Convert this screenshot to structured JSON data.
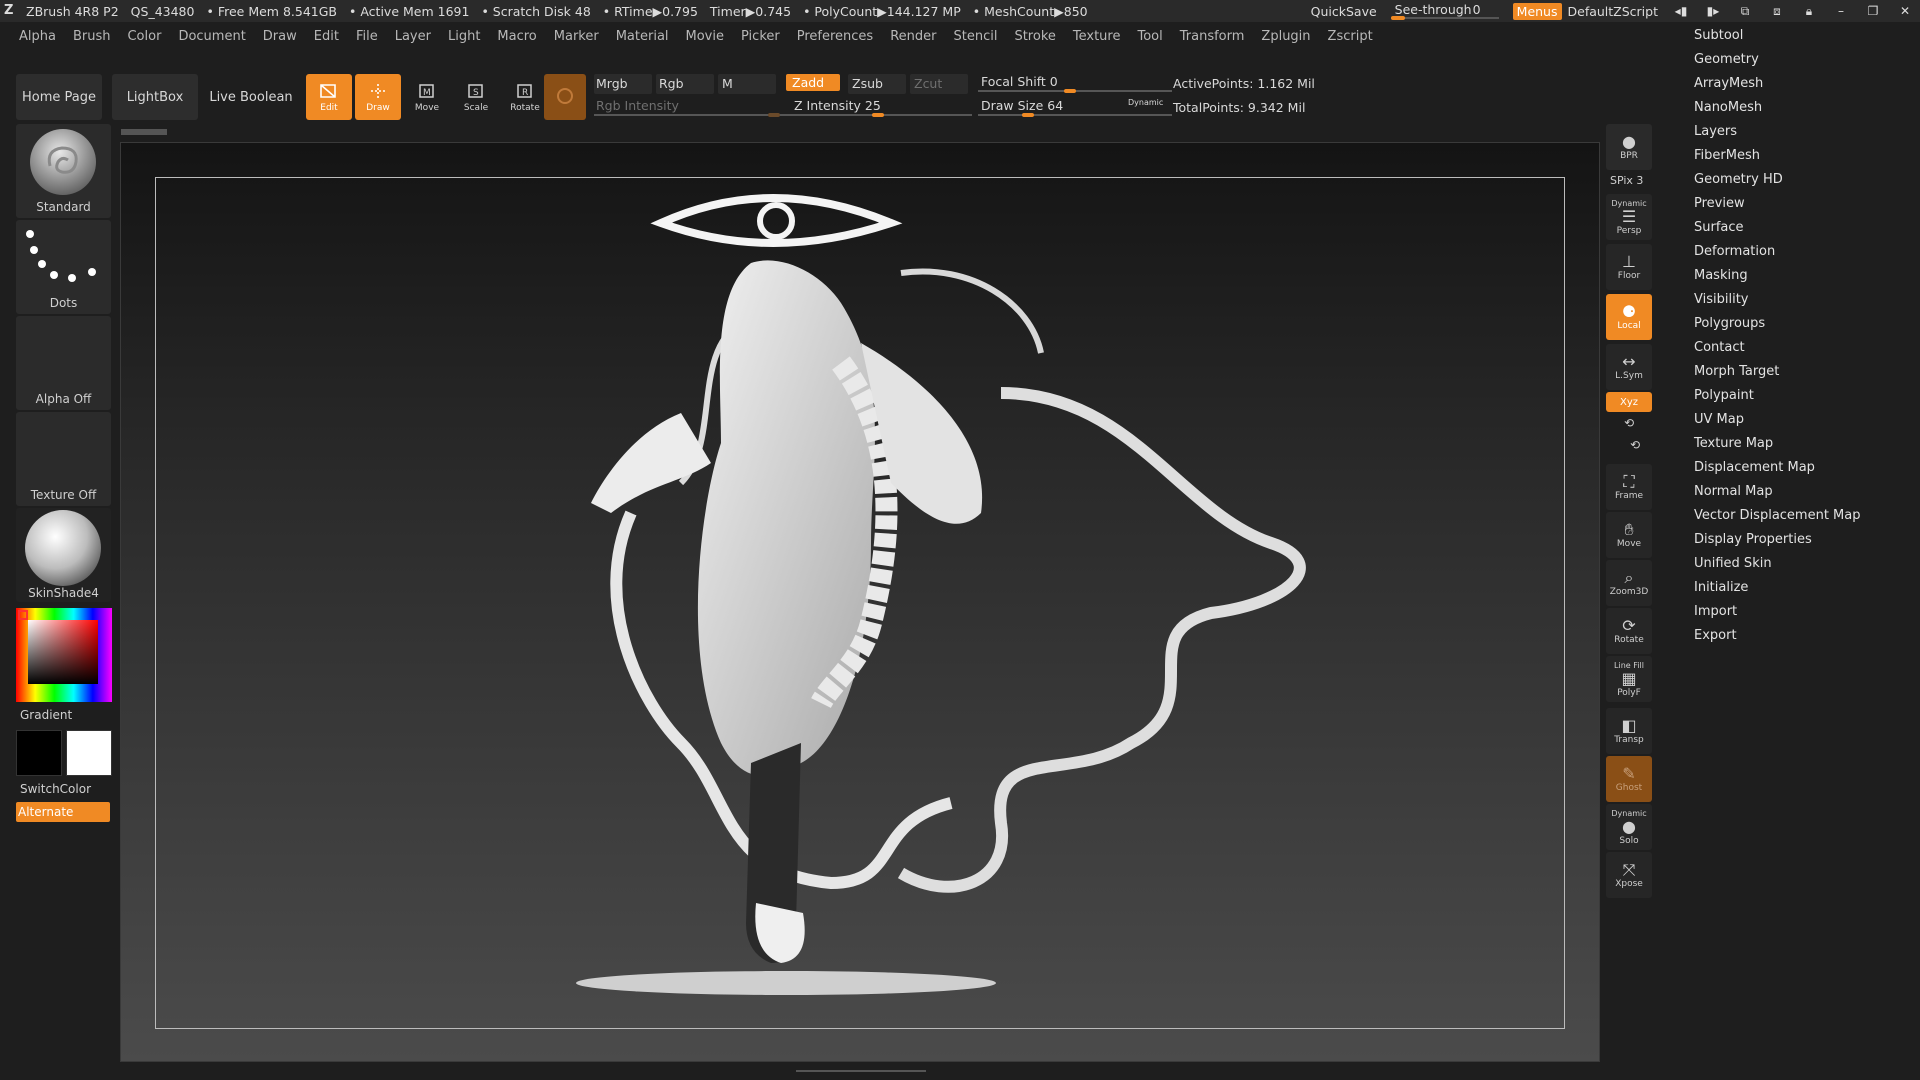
{
  "title_bar": {
    "app": "ZBrush 4R8 P2",
    "project": "QS_43480",
    "free_mem": "• Free Mem 8.541GB",
    "active_mem": "• Active Mem 1691",
    "scratch_disk": "• Scratch Disk 48",
    "rtime": "• RTime▶0.795",
    "timer": "Timer▶0.745",
    "polycount": "• PolyCount▶144.127 MP",
    "meshcount": "• MeshCount▶850",
    "quicksave": "QuickSave",
    "see_through_label": "See-through",
    "see_through_value": "0",
    "see_through_fraction": 0,
    "menus": "Menus",
    "default_zscript": "DefaultZScript"
  },
  "menu_bar": [
    "Alpha",
    "Brush",
    "Color",
    "Document",
    "Draw",
    "Edit",
    "File",
    "Layer",
    "Light",
    "Macro",
    "Marker",
    "Material",
    "Movie",
    "Picker",
    "Preferences",
    "Render",
    "Stencil",
    "Stroke",
    "Texture",
    "Tool",
    "Transform",
    "Zplugin",
    "Zscript"
  ],
  "tool_palette": [
    "Subtool",
    "Geometry",
    "ArrayMesh",
    "NanoMesh",
    "Layers",
    "FiberMesh",
    "Geometry HD",
    "Preview",
    "Surface",
    "Deformation",
    "Masking",
    "Visibility",
    "Polygroups",
    "Contact",
    "Morph Target",
    "Polypaint",
    "UV Map",
    "Texture Map",
    "Displacement Map",
    "Normal Map",
    "Vector Displacement Map",
    "Display Properties",
    "Unified Skin",
    "Initialize",
    "Import",
    "Export"
  ],
  "shelf": {
    "home_page": "Home Page",
    "lightbox": "LightBox",
    "live_boolean": "Live Boolean",
    "edit": "Edit",
    "draw": "Draw",
    "move": "Move",
    "scale": "Scale",
    "rotate": "Rotate",
    "mrgb": "Mrgb",
    "rgb": "Rgb",
    "m": "M",
    "rgb_intensity": "Rgb Intensity",
    "zadd": "Zadd",
    "zsub": "Zsub",
    "zcut": "Zcut",
    "z_intensity": "Z Intensity 25",
    "focal_shift": "Focal Shift 0",
    "draw_size": "Draw Size 64",
    "dynamic": "Dynamic",
    "active_points": "ActivePoints: 1.162 Mil",
    "total_points": "TotalPoints: 9.342 Mil"
  },
  "left_panel": {
    "brush": "Standard",
    "stroke": "Dots",
    "alpha": "Alpha Off",
    "texture": "Texture Off",
    "material": "SkinShade4",
    "gradient": "Gradient",
    "switch_color": "SwitchColor",
    "alternate": "Alternate"
  },
  "right_column": {
    "bpr": "BPR",
    "spix": "SPix 3",
    "dynamic": "Dynamic",
    "persp": "Persp",
    "floor": "Floor",
    "local": "Local",
    "lsym": "L.Sym",
    "xyz": "Xyz",
    "frame": "Frame",
    "move": "Move",
    "zoom3d": "Zoom3D",
    "rotate": "Rotate",
    "line_fill": "Line Fill",
    "polyf": "PolyF",
    "transp": "Transp",
    "ghost": "Ghost",
    "dynamic2": "Dynamic",
    "solo": "Solo",
    "xpose": "Xpose"
  },
  "colors": {
    "accent": "#f08a24",
    "background": "#1e1e1e",
    "panel": "#2b2b2b"
  }
}
